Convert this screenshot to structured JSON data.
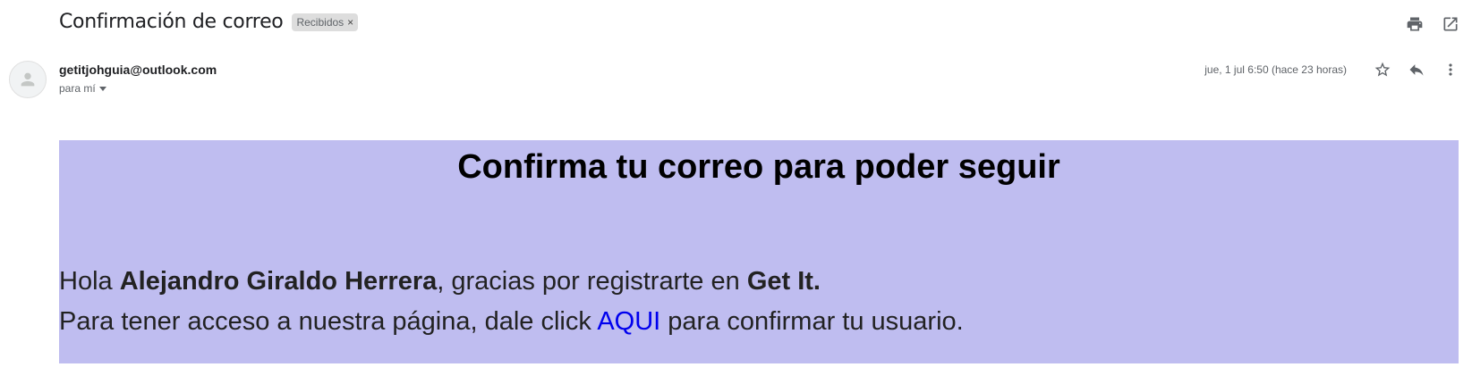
{
  "email": {
    "subject": "Confirmación de correo",
    "label": "Recibidos",
    "label_close": "×",
    "sender": "getitjohguia@outlook.com",
    "to": "para mí",
    "date": "jue, 1 jul 6:50 (hace 23 horas)"
  },
  "icons": {
    "print": "print-icon",
    "open_new_window": "open-in-new-icon",
    "avatar": "person-icon",
    "star": "star-icon",
    "reply": "reply-icon",
    "more": "more-vert-icon"
  },
  "body": {
    "title": "Confirma tu correo para poder seguir",
    "greeting": "Hola ",
    "name": "Alejandro Giraldo Herrera",
    "thanks": ", gracias por registrarte en ",
    "app_name": "Get It.",
    "line2_before": "Para tener acceso a nuestra página, dale click ",
    "link_text": "AQUI",
    "line2_after": " para confirmar tu usuario.",
    "background": "#bfbdf0",
    "link_color": "#0000ee"
  }
}
